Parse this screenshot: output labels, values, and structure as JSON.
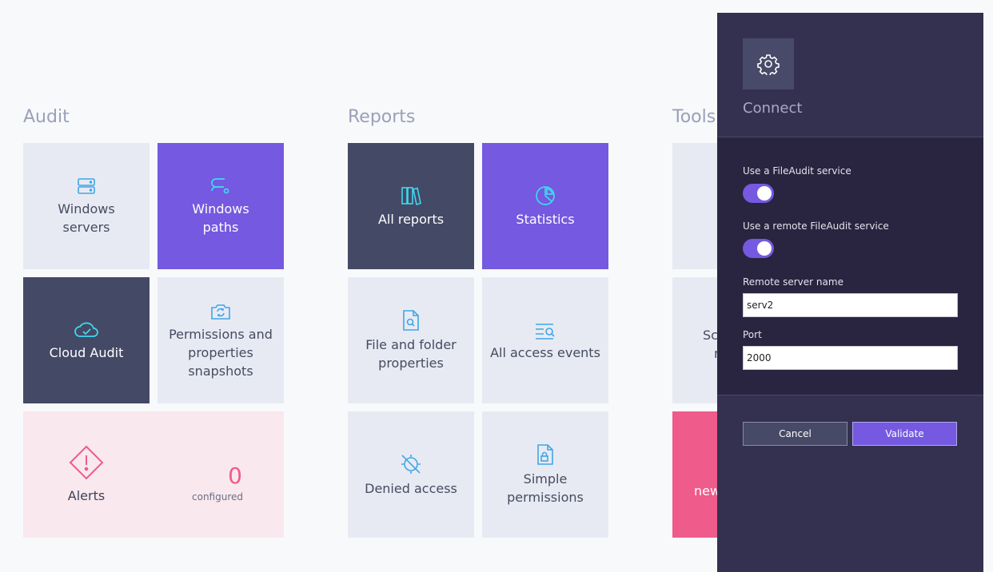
{
  "sections": {
    "audit": "Audit",
    "reports": "Reports",
    "tools": "Tools"
  },
  "audit": {
    "windows_servers": "Windows servers",
    "windows_paths": "Windows paths",
    "cloud_audit": "Cloud Audit",
    "permissions_snapshots": "Permissions and properties snapshots",
    "alerts": {
      "label": "Alerts",
      "count": "0",
      "sub": "configured"
    }
  },
  "reports": {
    "all_reports": "All reports",
    "statistics": "Statistics",
    "file_folder_properties": "File and folder properties",
    "all_access_events": "All access events",
    "denied_access": "Denied access",
    "simple_permissions": "Simple permissions"
  },
  "tools": {
    "partial_1": "Sc",
    "partial_2": "r",
    "partial_3": "new"
  },
  "panel": {
    "title": "Connect",
    "use_service_label": "Use a FileAudit service",
    "use_service_on": true,
    "use_remote_label": "Use a remote FileAudit service",
    "use_remote_on": true,
    "server_name_label": "Remote server name",
    "server_name_value": "serv2",
    "port_label": "Port",
    "port_value": "2000",
    "cancel_label": "Cancel",
    "validate_label": "Validate"
  },
  "icons": {
    "windows_servers": "server-icon",
    "windows_paths": "path-icon",
    "cloud_audit": "cloud-check-icon",
    "permissions_snapshots": "camera-refresh-icon",
    "alerts": "warning-diamond-icon",
    "all_reports": "books-icon",
    "statistics": "pie-chart-icon",
    "file_folder_properties": "file-search-icon",
    "all_access_events": "list-search-icon",
    "denied_access": "denied-icon",
    "simple_permissions": "file-lock-icon",
    "settings": "gear-icon"
  },
  "colors": {
    "accent_purple": "#7559e0",
    "dark_tile": "#444a66",
    "light_tile": "#e8eaf3",
    "alert_pink": "#ef5b8b",
    "icon_cyan": "#3fc2f0"
  }
}
